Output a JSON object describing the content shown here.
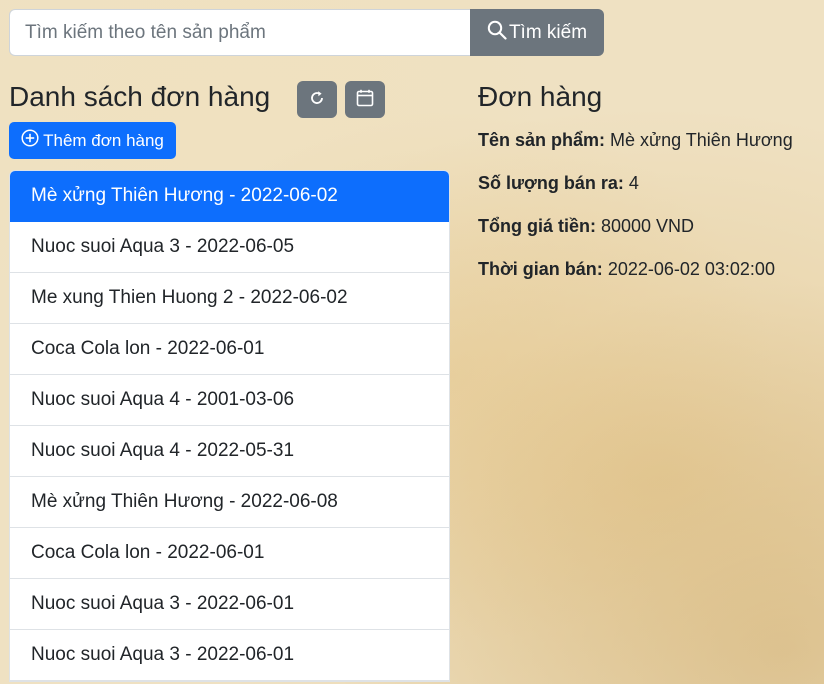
{
  "search": {
    "placeholder": "Tìm kiếm theo tên sản phẩm",
    "button_label": "Tìm kiếm"
  },
  "list": {
    "title": "Danh sách đơn hàng",
    "add_label": "Thêm đơn hàng",
    "items": [
      "Mè xửng Thiên Hương - 2022-06-02",
      "Nuoc suoi Aqua 3 - 2022-06-05",
      "Me xung Thien Huong 2 - 2022-06-02",
      "Coca Cola lon - 2022-06-01",
      "Nuoc suoi Aqua 4 - 2001-03-06",
      "Nuoc suoi Aqua 4 - 2022-05-31",
      "Mè xửng Thiên Hương - 2022-06-08",
      "Coca Cola lon - 2022-06-01",
      "Nuoc suoi Aqua 3 - 2022-06-01",
      "Nuoc suoi Aqua 3 - 2022-06-01"
    ]
  },
  "detail": {
    "title": "Đơn hàng",
    "product_label": "Tên sản phẩm:",
    "product_value": "Mè xửng Thiên Hương",
    "quantity_label": "Số lượng bán ra:",
    "quantity_value": "4",
    "total_label": "Tổng giá tiền:",
    "total_value": "80000 VND",
    "time_label": "Thời gian bán:",
    "time_value": "2022-06-02 03:02:00"
  },
  "icons": {
    "search": "search-icon",
    "refresh": "refresh-icon",
    "calendar": "calendar-icon",
    "add": "plus-circle-icon"
  },
  "colors": {
    "primary": "#0d6efd",
    "secondary": "#6c757d"
  }
}
